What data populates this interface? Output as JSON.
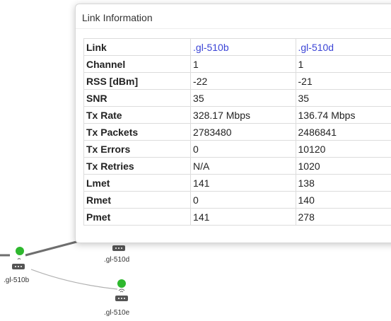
{
  "popup": {
    "title": "Link Information",
    "table": {
      "header": {
        "label": "Link",
        "col1": ".gl-510b",
        "col2": ".gl-510d"
      },
      "rows": [
        {
          "label": "Channel",
          "col1": "1",
          "col2": "1"
        },
        {
          "label": "RSS [dBm]",
          "col1": "-22",
          "col2": "-21"
        },
        {
          "label": "SNR",
          "col1": "35",
          "col2": "35"
        },
        {
          "label": "Tx Rate",
          "col1": "328.17 Mbps",
          "col2": "136.74 Mbps"
        },
        {
          "label": "Tx Packets",
          "col1": "2783480",
          "col2": "2486841"
        },
        {
          "label": "Tx Errors",
          "col1": "0",
          "col2": "10120"
        },
        {
          "label": "Tx Retries",
          "col1": "N/A",
          "col2": "1020"
        },
        {
          "label": "Lmet",
          "col1": "141",
          "col2": "138"
        },
        {
          "label": "Rmet",
          "col1": "0",
          "col2": "140"
        },
        {
          "label": "Pmet",
          "col1": "141",
          "col2": "278"
        }
      ]
    }
  },
  "topology": {
    "nodes": [
      {
        "label": ".gl-510b",
        "status_color": "#2eb82e"
      },
      {
        "label": ".gl-510d",
        "status_color": "#2eb82e"
      },
      {
        "label": ".gl-510e",
        "status_color": "#2eb82e"
      }
    ]
  }
}
